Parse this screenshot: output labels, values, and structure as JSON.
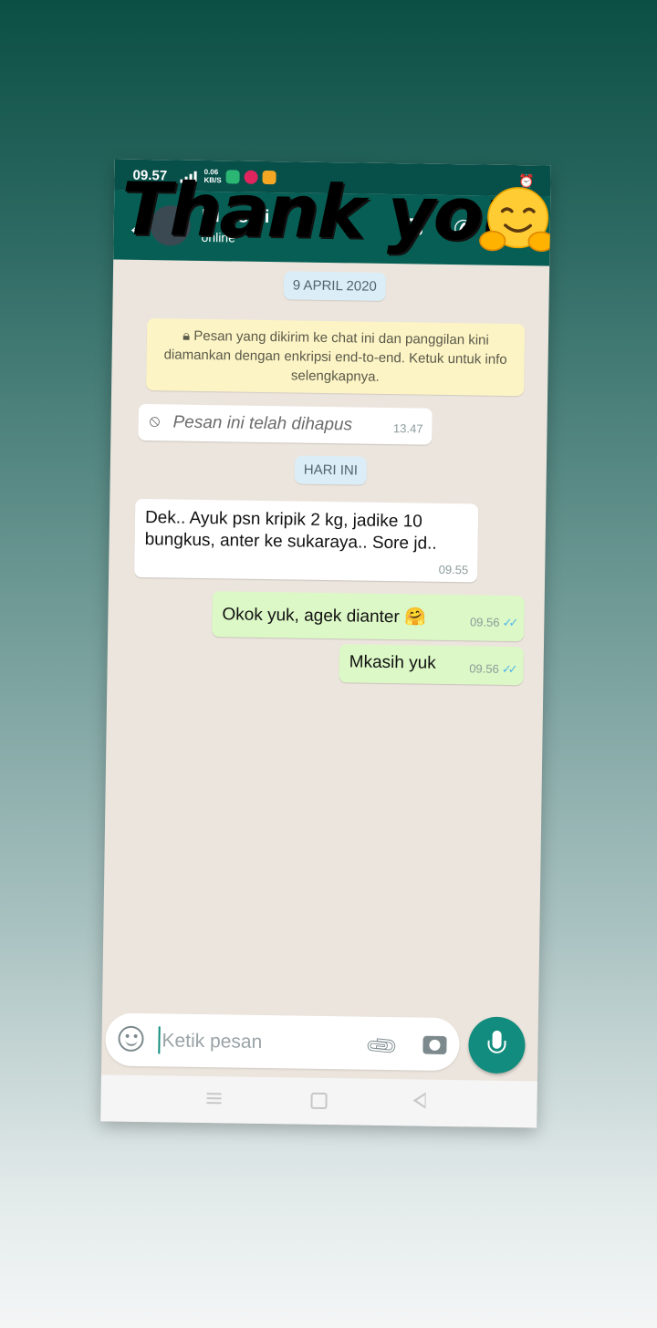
{
  "status_bar": {
    "time": "09.57",
    "net_speed": "0.06",
    "net_unit": "KB/S"
  },
  "header": {
    "contact_name": "Ki…smi",
    "contact_status": "online"
  },
  "overlay": {
    "sticker_text": "Thank you",
    "sticker_emoji": "hugging-face"
  },
  "chat": {
    "date_chip_1": "9 APRIL 2020",
    "encryption_notice": "Pesan yang dikirim ke chat ini dan panggilan kini diamankan dengan enkripsi end-to-end. Ketuk untuk info selengkapnya.",
    "deleted_message": {
      "text": "Pesan ini telah dihapus",
      "time": "13.47"
    },
    "date_chip_2": "HARI INI",
    "messages": [
      {
        "direction": "incoming",
        "text": "Dek.. Ayuk psn kripik 2 kg,  jadike 10 bungkus,  anter ke sukaraya.. Sore jd..",
        "time": "09.55"
      },
      {
        "direction": "outgoing",
        "text": "Okok yuk, agek dianter 🤗",
        "time": "09.56",
        "read": true
      },
      {
        "direction": "outgoing",
        "text": "Mkasih yuk",
        "time": "09.56",
        "read": true
      }
    ]
  },
  "composer": {
    "placeholder": "Ketik pesan"
  },
  "colors": {
    "header": "#075e54",
    "outgoing_bubble": "#dcf8c6",
    "accent": "#128c7e",
    "read_ticks": "#4fb6ec"
  }
}
